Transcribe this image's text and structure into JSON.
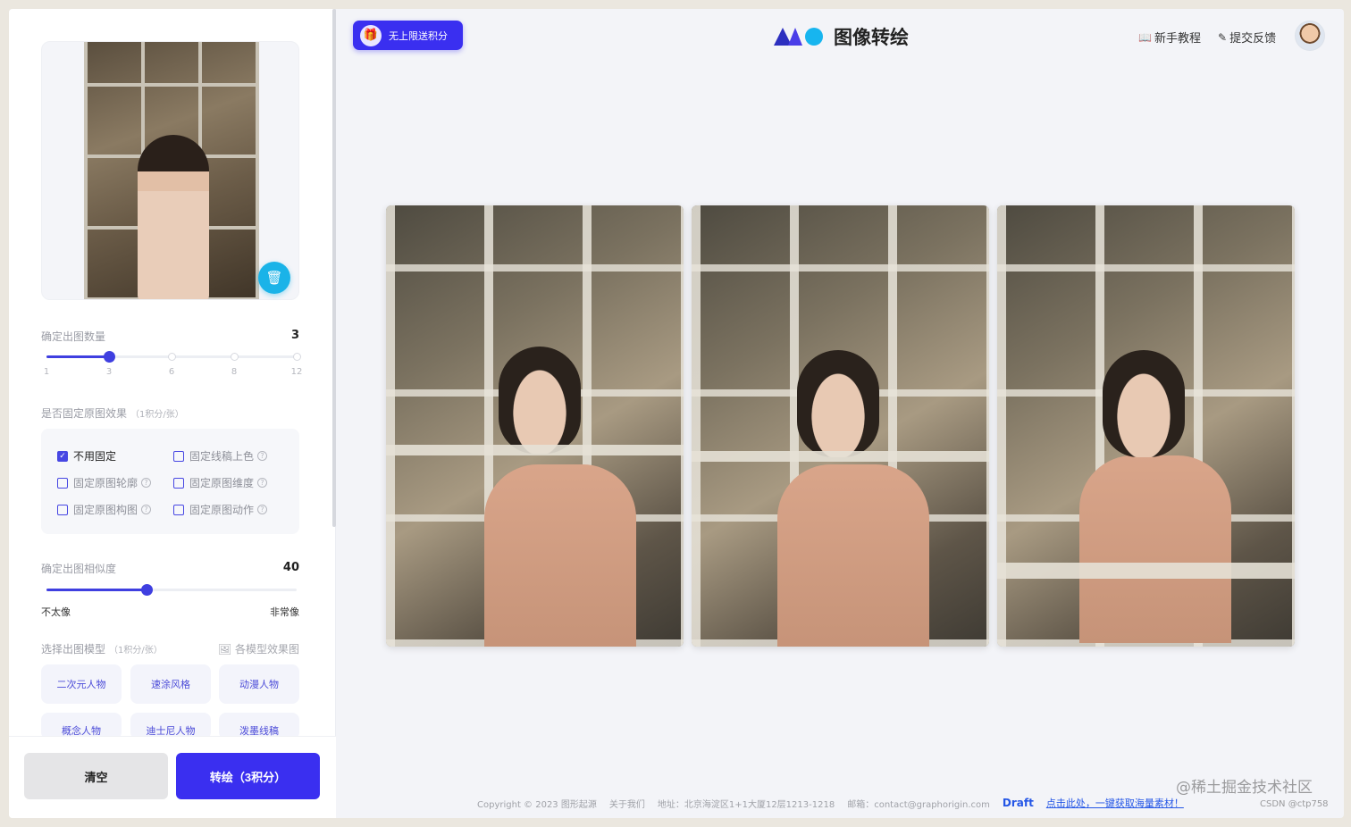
{
  "header": {
    "promo_label": "无上限送积分",
    "brand_title": "图像转绘",
    "tutorial_label": "新手教程",
    "feedback_label": "提交反馈"
  },
  "sidebar": {
    "count_label": "确定出图数量",
    "count_value": "3",
    "count_ticks": [
      "1",
      "3",
      "6",
      "8",
      "12"
    ],
    "count_fraction": 0.25,
    "fix_title": "是否固定原图效果",
    "fix_sub": "（1积分/张）",
    "fix_options": [
      {
        "label": "不用固定",
        "checked": true
      },
      {
        "label": "固定线稿上色",
        "checked": false
      },
      {
        "label": "固定原图轮廓",
        "checked": false
      },
      {
        "label": "固定原图维度",
        "checked": false
      },
      {
        "label": "固定原图构图",
        "checked": false
      },
      {
        "label": "固定原图动作",
        "checked": false
      }
    ],
    "similarity_label": "确定出图相似度",
    "similarity_value": "40",
    "similarity_fraction": 0.4,
    "similarity_low": "不太像",
    "similarity_high": "非常像",
    "model_title": "选择出图模型",
    "model_sub": "（1积分/张）",
    "model_link": "各模型效果图",
    "models": [
      "二次元人物",
      "速涂风格",
      "动漫人物",
      "概念人物",
      "迪士尼人物",
      "泼墨线稿"
    ],
    "clear_label": "清空",
    "convert_label": "转绘（3积分）"
  },
  "footer": {
    "copyright": "Copyright © 2023 图形起源",
    "about": "关于我们",
    "address": "地址：北京海淀区1+1大厦12层1213-1218",
    "email": "邮箱：contact@graphorigin.com",
    "draft": "Draft",
    "draft_link": "点击此处，一键获取海量素材！"
  },
  "watermark": {
    "main": "@稀土掘金技术社区",
    "sub": "CSDN @ctp758"
  },
  "icons": {
    "delete": "trash-icon",
    "gift": "gift-icon",
    "book": "book-icon",
    "edit": "edit-icon",
    "help": "question-icon"
  },
  "colors": {
    "primary": "#3a2ff0",
    "accent": "#17b5ef"
  }
}
